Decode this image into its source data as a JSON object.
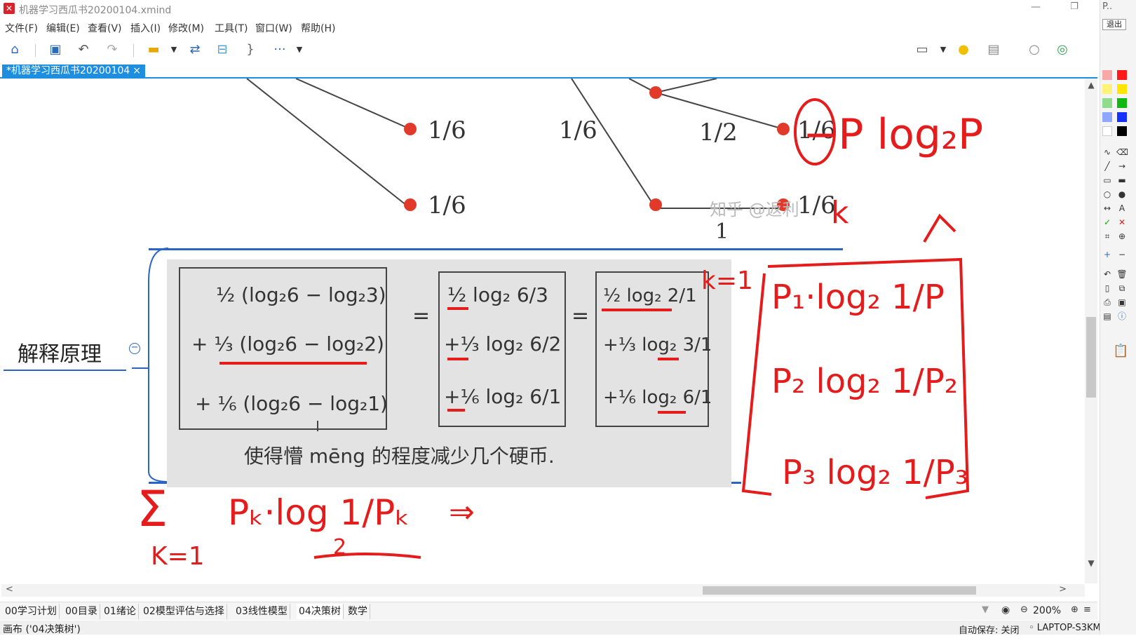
{
  "window": {
    "title": "机器学习西瓜书20200104.xmind",
    "min": "—",
    "restore": "❐"
  },
  "menu": [
    "文件(F)",
    "编辑(E)",
    "查看(V)",
    "插入(I)",
    "修改(M)",
    "工具(T)",
    "窗口(W)",
    "帮助(H)"
  ],
  "toolbar": {
    "icons": [
      "home-icon",
      "save-icon",
      "undo-icon",
      "redo-icon",
      "topic-icon",
      "relationship-icon",
      "boundary-icon",
      "summary-icon",
      "more-icon",
      "presentation-icon",
      "bulb-icon",
      "layout-icon",
      "search-icon",
      "share-icon"
    ],
    "more_label": "···"
  },
  "doc_tab": {
    "label": "*机器学习西瓜书20200104",
    "close": "×"
  },
  "canvas": {
    "topic": "解释原理",
    "collapse": "−",
    "tree_fractions": [
      "1/6",
      "1/6",
      "1/2",
      "1/6",
      "1/6",
      "1/6",
      "1"
    ],
    "watermark": "知乎 @返利",
    "handwriting": {
      "col1_row1": "½ (log₂6 − log₂3)",
      "col1_row2": "+ ⅓ (log₂6 − log₂2)",
      "col1_row3": "+ ⅙ (log₂6 − log₂1)",
      "eq": "=",
      "col2_row1": "½ log₂ 6/3",
      "col2_row2": "+⅓ log₂ 6/2",
      "col2_row3": "+⅙ log₂ 6/1",
      "col3_row1": "½ log₂ 2/1",
      "col3_row2": "+⅓ log₂ 3/1",
      "col3_row3": "+⅙ log₂ 6/1",
      "note": "使得懵 mēng 的程度减少几个硬币."
    },
    "red_annotations": {
      "top": "−P log₂P",
      "k": "k",
      "k_eq_1": "k=1",
      "p1": "P₁·log₂ 1/P",
      "p2": "P₂ log₂ 1/P₂",
      "p3": "P₃ log₂ 1/P₃",
      "sum": "Σ",
      "sum_k": "K=1",
      "pk": "Pₖ·log 1/Pₖ",
      "log_base": "2",
      "implies": "⇒"
    }
  },
  "scroll": {
    "up": "▲",
    "down": "▼",
    "left": "<",
    "right": ">"
  },
  "sheets": [
    "00学习计划",
    "00目录",
    "01绪论",
    "02模型评估与选择",
    "03线性模型",
    "04决策树",
    "数学"
  ],
  "active_sheet": "04决策树",
  "zoom": {
    "level": "200%",
    "out": "⊖",
    "in": "⊕",
    "menu": "≡"
  },
  "status": {
    "left": "画布 ('04决策树')",
    "autosave": "自动保存: 关闭",
    "machine": "◦ LAPTOP-S3KMG0V9"
  },
  "pen_panel": {
    "exit": "退出",
    "p": "P..",
    "colors": [
      "#f7a9a9",
      "#ff1a1a",
      "#fff27a",
      "#ffe500",
      "#8fdc8f",
      "#11b811",
      "#8fa8ff",
      "#1432ff",
      "#ffffff",
      "#000000"
    ]
  },
  "colors": {
    "accent": "#1e8fe0",
    "ink_red": "#e51c1c",
    "branch_blue": "#2a65c5"
  }
}
